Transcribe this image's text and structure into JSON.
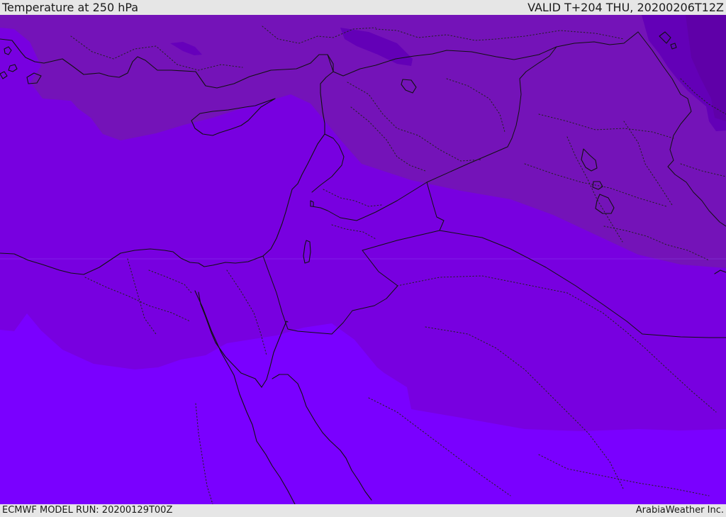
{
  "header": {
    "title": "Temperature at 250 hPa",
    "valid_time": "VALID T+204 THU, 20200206T12Z"
  },
  "footer": {
    "model_run": "ECMWF MODEL RUN: 20200129T00Z",
    "credit": "ArabiaWeather Inc."
  },
  "map": {
    "background_color": "#e6e6e6",
    "shading_colors": [
      "#5f00a8",
      "#7413b8",
      "#7800e0",
      "#7a00ff"
    ],
    "coast_color": "#111111",
    "border_style": "dotted"
  }
}
